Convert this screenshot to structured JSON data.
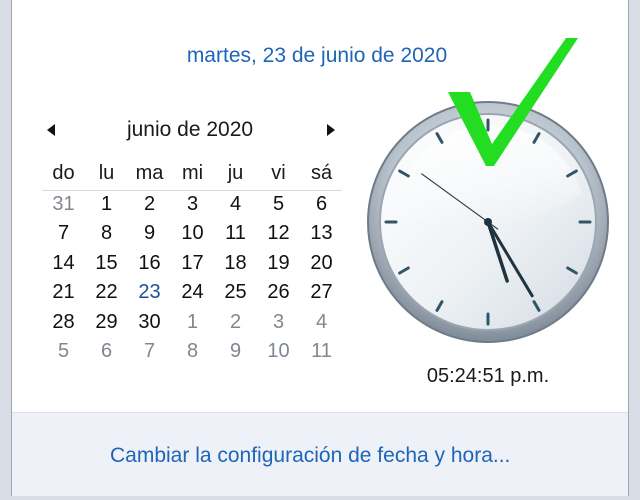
{
  "date_link": "martes, 23 de junio de 2020",
  "calendar": {
    "month_title": "junio de 2020",
    "prev_icon": "triangle-left-icon",
    "next_icon": "triangle-right-icon",
    "weekdays": [
      "do",
      "lu",
      "ma",
      "mi",
      "ju",
      "vi",
      "sá"
    ],
    "weeks": [
      [
        "31",
        "1",
        "2",
        "3",
        "4",
        "5",
        "6"
      ],
      [
        "7",
        "8",
        "9",
        "10",
        "11",
        "12",
        "13"
      ],
      [
        "14",
        "15",
        "16",
        "17",
        "18",
        "19",
        "20"
      ],
      [
        "21",
        "22",
        "23",
        "24",
        "25",
        "26",
        "27"
      ],
      [
        "28",
        "29",
        "30",
        "1",
        "2",
        "3",
        "4"
      ],
      [
        "5",
        "6",
        "7",
        "8",
        "9",
        "10",
        "11"
      ]
    ],
    "other_month_days": [
      "0-0",
      "4-3",
      "4-4",
      "4-5",
      "4-6",
      "5-0",
      "5-1",
      "5-2",
      "5-3",
      "5-4",
      "5-5",
      "5-6"
    ],
    "today_cell": "3-2"
  },
  "clock": {
    "hours": 5,
    "minutes": 24,
    "seconds": 51,
    "time_text": "05:24:51 p.m."
  },
  "footer": {
    "change_link": "Cambiar la configuración de fecha y hora..."
  },
  "overlay": {
    "icon": "green-checkmark-icon",
    "color": "#22dd22"
  },
  "colors": {
    "link": "#1e65b7",
    "today_border": "#3b7ad0"
  }
}
